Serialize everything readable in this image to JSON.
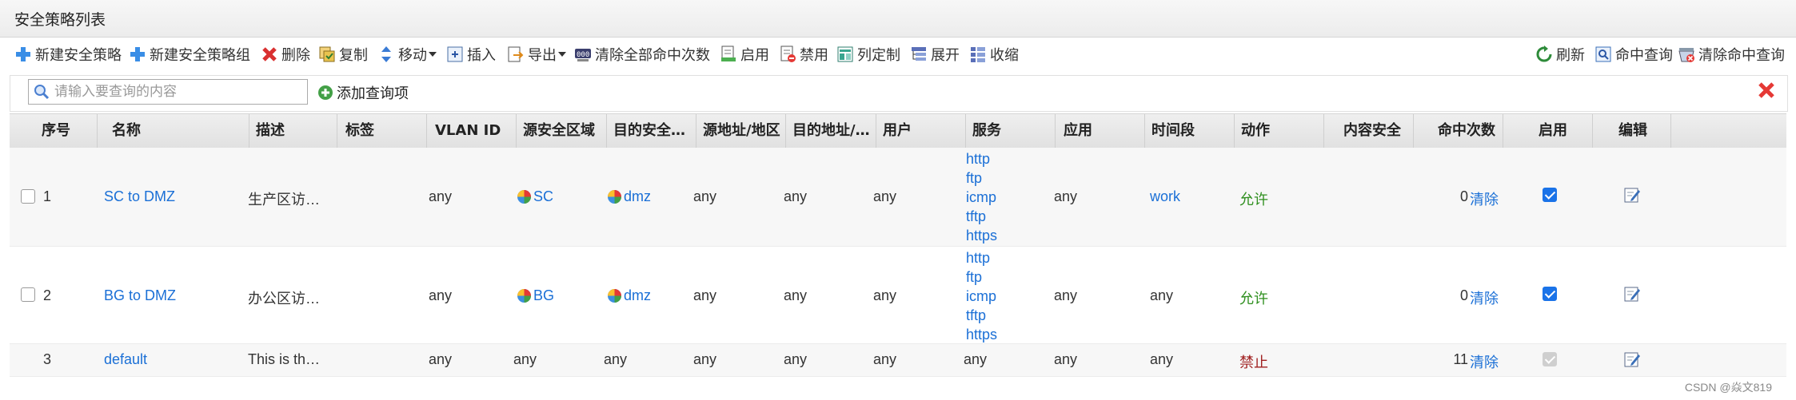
{
  "title": "安全策略列表",
  "toolbar": {
    "new_policy": "新建安全策略",
    "new_group": "新建安全策略组",
    "delete": "删除",
    "copy": "复制",
    "move": "移动",
    "insert": "插入",
    "export": "导出",
    "clear_all_hits": "清除全部命中次数",
    "enable": "启用",
    "disable": "禁用",
    "customize_columns": "列定制",
    "expand": "展开",
    "collapse": "收缩",
    "refresh": "刷新",
    "hit_query": "命中查询",
    "clear_hit_query": "清除命中查询"
  },
  "search": {
    "placeholder": "请输入要查询的内容",
    "add_query": "添加查询项"
  },
  "columns": {
    "seq": "序号",
    "name": "名称",
    "desc": "描述",
    "tag": "标签",
    "vlan": "VLAN ID",
    "src_zone": "源安全区域",
    "dst_zone": "目的安全…",
    "src_addr": "源地址/地区",
    "dst_addr": "目的地址/…",
    "user": "用户",
    "service": "服务",
    "app": "应用",
    "time": "时间段",
    "action": "动作",
    "content": "内容安全",
    "hits": "命中次数",
    "enabled": "启用",
    "edit": "编辑"
  },
  "rows": [
    {
      "seq": "1",
      "name": "SC to DMZ",
      "desc": "生产区访…",
      "tag": "",
      "vlan": "any",
      "src_zone": "SC",
      "dst_zone": "dmz",
      "src_addr": "any",
      "dst_addr": "any",
      "user": "any",
      "services": [
        "http",
        "ftp",
        "icmp",
        "tftp",
        "https"
      ],
      "app": "any",
      "time": "work",
      "action": "允许",
      "content": "",
      "hits": "0",
      "clear": "清除",
      "enabled": true
    },
    {
      "seq": "2",
      "name": "BG to DMZ",
      "desc": "办公区访…",
      "tag": "",
      "vlan": "any",
      "src_zone": "BG",
      "dst_zone": "dmz",
      "src_addr": "any",
      "dst_addr": "any",
      "user": "any",
      "services": [
        "http",
        "ftp",
        "icmp",
        "tftp",
        "https"
      ],
      "app": "any",
      "time": "any",
      "action": "允许",
      "content": "",
      "hits": "0",
      "clear": "清除",
      "enabled": true
    },
    {
      "seq": "3",
      "name": "default",
      "desc": "This is th…",
      "tag": "",
      "vlan": "any",
      "src_zone": "any",
      "dst_zone": "any",
      "src_addr": "any",
      "dst_addr": "any",
      "user": "any",
      "services": [
        "any"
      ],
      "app": "any",
      "time": "any",
      "action": "禁止",
      "content": "",
      "hits": "11",
      "clear": "清除",
      "enabled": true
    }
  ],
  "watermark": "CSDN @焱文819",
  "colors": {
    "link": "#1a6fd6",
    "allow": "#2f8f1f",
    "deny": "#a02020",
    "checkbox": "#1a73e8"
  }
}
